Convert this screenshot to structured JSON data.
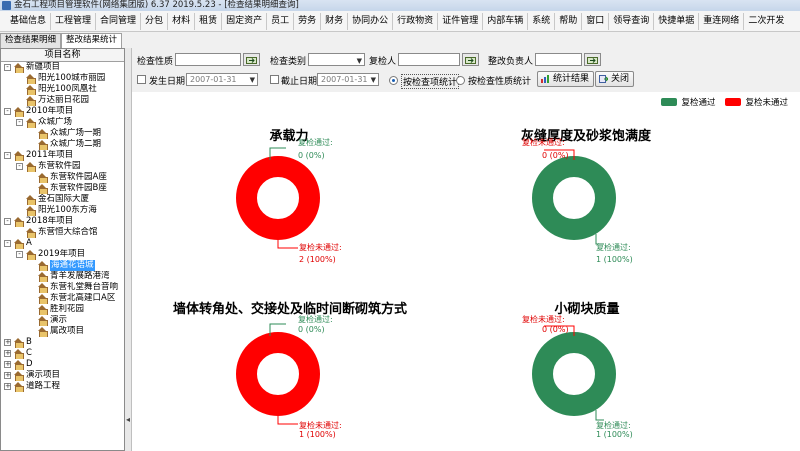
{
  "window": {
    "title": "金石工程项目管理软件(网络集团版) 6.37  2019.5.23 - [检查结果明细查询]"
  },
  "menu": [
    "基础信息",
    "工程管理",
    "合同管理",
    "分包",
    "材料",
    "租赁",
    "固定资产",
    "员工",
    "劳务",
    "财务",
    "协同办公",
    "行政物资",
    "证件管理",
    "内部车辆",
    "系统",
    "帮助",
    "窗口",
    "领导查询",
    "快捷单据",
    "重连网络",
    "二次开发"
  ],
  "tabs": [
    "检查结果明细",
    "整改结果统计"
  ],
  "tree": {
    "header": "项目名称",
    "nodes": [
      {
        "label": "新疆项目",
        "level": 0,
        "exp": "-"
      },
      {
        "label": "阳光100城市丽园",
        "level": 1
      },
      {
        "label": "阳光100凤凰社",
        "level": 1
      },
      {
        "label": "万达丽日花园",
        "level": 1
      },
      {
        "label": "2010年项目",
        "level": 0,
        "exp": "-"
      },
      {
        "label": "众城广场",
        "level": 1,
        "exp": "-"
      },
      {
        "label": "众城广场一期",
        "level": 2
      },
      {
        "label": "众城广场二期",
        "level": 2
      },
      {
        "label": "2011年项目",
        "level": 0,
        "exp": "-"
      },
      {
        "label": "东营软件园",
        "level": 1,
        "exp": "-"
      },
      {
        "label": "东营软件园A座",
        "level": 2
      },
      {
        "label": "东营软件园B座",
        "level": 2
      },
      {
        "label": "金石国际大厦",
        "level": 1
      },
      {
        "label": "阳光100东方海",
        "level": 1
      },
      {
        "label": "2018年项目",
        "level": 0,
        "exp": "-"
      },
      {
        "label": "东营恒大综合馆",
        "level": 1
      },
      {
        "label": "A",
        "level": 0,
        "exp": "-"
      },
      {
        "label": "2019年项目",
        "level": 1,
        "exp": "-"
      },
      {
        "label": "海通花语城",
        "level": 2,
        "selected": true
      },
      {
        "label": "青羊发展路港湾",
        "level": 2
      },
      {
        "label": "东营礼堂舞台音响",
        "level": 2
      },
      {
        "label": "东营北高建口A区",
        "level": 2
      },
      {
        "label": "胜利花园",
        "level": 2
      },
      {
        "label": "演示",
        "level": 2
      },
      {
        "label": "属改项目",
        "level": 2
      },
      {
        "label": "B",
        "level": 0,
        "exp": "+"
      },
      {
        "label": "C",
        "level": 0,
        "exp": "+"
      },
      {
        "label": "D",
        "level": 0,
        "exp": "+"
      },
      {
        "label": "演示项目",
        "level": 0,
        "exp": "+"
      },
      {
        "label": "道路工程",
        "level": 0,
        "exp": "+"
      }
    ]
  },
  "filters": {
    "check_nature_label": "检查性质",
    "check_nature_value": "",
    "check_category_label": "检查类别",
    "check_category_value": "",
    "reviewer_label": "复检人",
    "reviewer_value": "",
    "rectify_owner_label": "整改负责人",
    "rectify_owner_value": "",
    "occur_date_label": "发生日期",
    "occur_date_value": "2007-01-31",
    "end_date_label": "截止日期",
    "end_date_value": "2007-01-31",
    "radio_by_item": "按检查项统计",
    "radio_by_nature": "按检查性质统计",
    "stats_button": "统计结果",
    "close_button": "关闭"
  },
  "legend": {
    "pass_label": "复检通过",
    "fail_label": "复检未通过",
    "pass_color": "#2e8b57",
    "fail_color": "#ff0000"
  },
  "charts": [
    {
      "title": "承载力",
      "pass_label": "复检通过:",
      "pass_value": "0 (0%)",
      "fail_label": "复检未通过:",
      "fail_value": "2 (100%)",
      "pass": 0,
      "fail": 2
    },
    {
      "title": "灰缝厚度及砂浆饱满度",
      "pass_label": "复检通过:",
      "pass_value": "1 (100%)",
      "fail_label": "复检未通过:",
      "fail_value": "0 (0%)",
      "pass": 1,
      "fail": 0
    },
    {
      "title": "墙体转角处、交接处及临时间断砌筑方式",
      "pass_label": "复检通过:",
      "pass_value": "0 (0%)",
      "fail_label": "复检未通过:",
      "fail_value": "1 (100%)",
      "pass": 0,
      "fail": 1
    },
    {
      "title": "小砌块质量",
      "pass_label": "复检通过:",
      "pass_value": "1 (100%)",
      "fail_label": "复检未通过:",
      "fail_value": "0 (0%)",
      "pass": 1,
      "fail": 0
    }
  ],
  "chart_data": [
    {
      "type": "pie",
      "title": "承载力",
      "categories": [
        "复检通过",
        "复检未通过"
      ],
      "values": [
        0,
        2
      ]
    },
    {
      "type": "pie",
      "title": "灰缝厚度及砂浆饱满度",
      "categories": [
        "复检通过",
        "复检未通过"
      ],
      "values": [
        1,
        0
      ]
    },
    {
      "type": "pie",
      "title": "墙体转角处、交接处及临时间断砌筑方式",
      "categories": [
        "复检通过",
        "复检未通过"
      ],
      "values": [
        0,
        1
      ]
    },
    {
      "type": "pie",
      "title": "小砌块质量",
      "categories": [
        "复检通过",
        "复检未通过"
      ],
      "values": [
        1,
        0
      ]
    }
  ]
}
